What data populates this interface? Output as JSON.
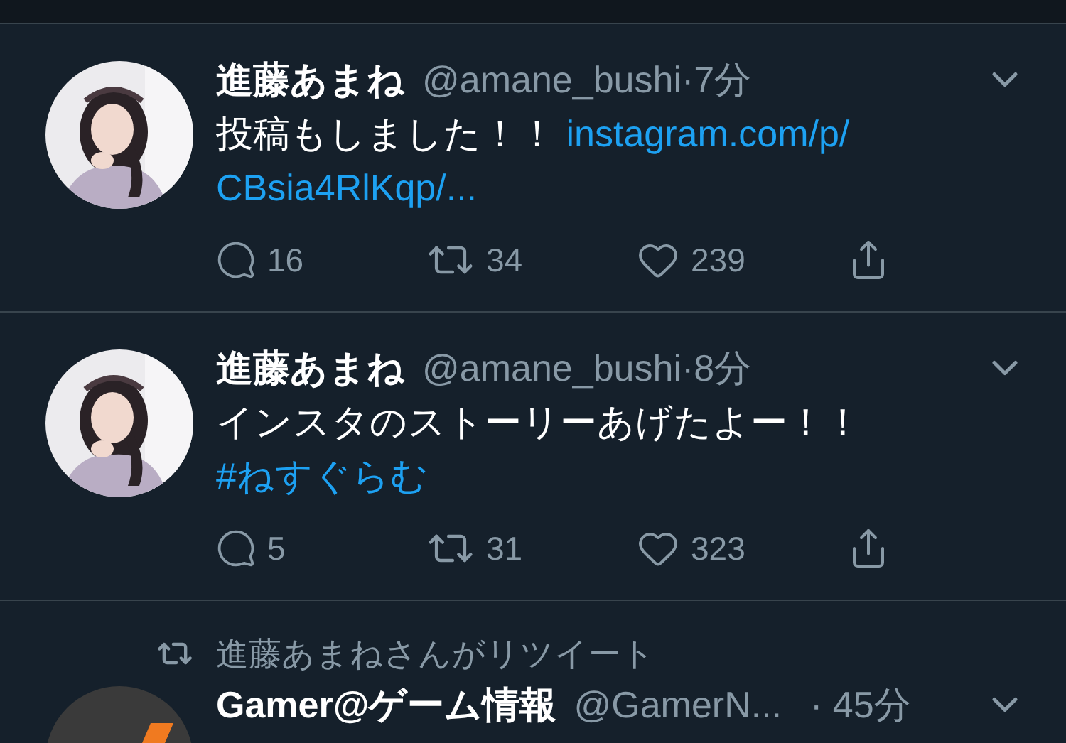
{
  "tweets": [
    {
      "kind": "tweet",
      "avatar": {
        "kind": "picture"
      },
      "name": "進藤あまね",
      "handle": "@amane_bushi",
      "time": "·7分",
      "lines": [
        [
          {
            "kind": "plain",
            "text": "投稿もしました！！ "
          },
          {
            "kind": "link",
            "text": "instagram.com/p/"
          }
        ],
        [
          {
            "kind": "link",
            "text": "CBsia4RlKqp/..."
          }
        ]
      ],
      "replies": "16",
      "retweets": "34",
      "likes": "239"
    },
    {
      "kind": "tweet",
      "avatar": {
        "kind": "picture"
      },
      "name": "進藤あまね",
      "handle": "@amane_bushi",
      "time": "·8分",
      "lines": [
        [
          {
            "kind": "plain",
            "text": "インスタのストーリーあげたよー！！"
          }
        ],
        [
          {
            "kind": "hashtag",
            "text": "#ねすぐらむ"
          }
        ]
      ],
      "replies": "5",
      "retweets": "31",
      "likes": "323"
    },
    {
      "kind": "retweet",
      "retweeted_by": "進藤あまねさんがリツイート",
      "avatar": {
        "kind": "logo"
      },
      "name": "Gamer@ゲーム情報",
      "handle": "@GamerN...",
      "time": "· 45分"
    }
  ]
}
